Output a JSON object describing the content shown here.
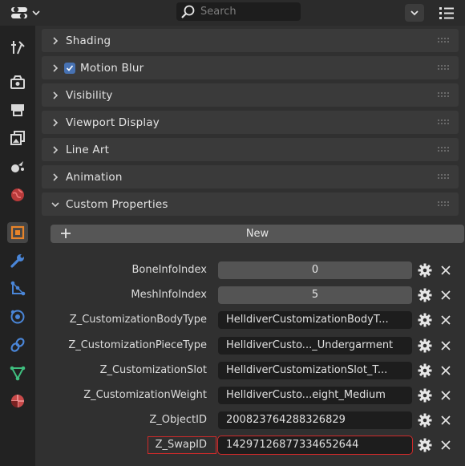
{
  "search": {
    "placeholder": "Search"
  },
  "panels": [
    {
      "label": "Shading"
    },
    {
      "label": "Motion Blur",
      "checked": true
    },
    {
      "label": "Visibility"
    },
    {
      "label": "Viewport Display"
    },
    {
      "label": "Line Art"
    },
    {
      "label": "Animation"
    },
    {
      "label": "Custom Properties",
      "expanded": true
    }
  ],
  "custom_properties": {
    "new_label": "New",
    "rows": [
      {
        "name": "BoneInfoIndex",
        "value": "0"
      },
      {
        "name": "MeshInfoIndex",
        "value": "5"
      },
      {
        "name": "Z_CustomizationBodyType",
        "value": "HelldiverCustomizationBodyT..."
      },
      {
        "name": "Z_CustomizationPieceType",
        "value": "HelldiverCusto..._Undergarment"
      },
      {
        "name": "Z_CustomizationSlot",
        "value": "HelldiverCustomizationSlot_T..."
      },
      {
        "name": "Z_CustomizationWeight",
        "value": "HelldiverCusto...eight_Medium"
      },
      {
        "name": "Z_ObjectID",
        "value": "200823764288326829"
      },
      {
        "name": "Z_SwapID",
        "value": "14297126877334652644",
        "highlighted": true
      }
    ]
  },
  "sidebar": [
    "tool-icon",
    "render-icon",
    "output-icon",
    "view-layer-icon",
    "scene-icon",
    "world-icon",
    "object-icon",
    "modifier-icon",
    "particles-icon",
    "physics-icon",
    "constraints-icon",
    "data-icon",
    "material-icon"
  ],
  "colors": {
    "accent_blue": "#4772b3",
    "highlight_red": "#d02a2a",
    "active_orange": "#e8842a"
  }
}
